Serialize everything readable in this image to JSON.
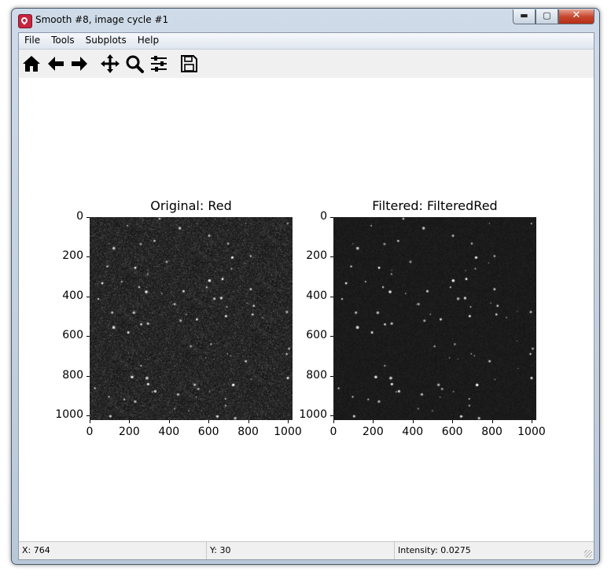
{
  "window": {
    "title": "Smooth #8, image cycle #1"
  },
  "titlebar_buttons": {
    "minimize": "▬",
    "maximize": "▢",
    "close": "✕"
  },
  "menu": [
    "File",
    "Tools",
    "Subplots",
    "Help"
  ],
  "toolbar": [
    {
      "name": "home-icon"
    },
    {
      "name": "back-arrow-icon"
    },
    {
      "name": "forward-arrow-icon"
    },
    {
      "name": "pan-icon"
    },
    {
      "name": "zoom-icon"
    },
    {
      "name": "configure-subplots-icon"
    },
    {
      "name": "save-icon"
    }
  ],
  "plots": [
    {
      "title": "Original: Red",
      "y_ticks": [
        "0",
        "200",
        "400",
        "600",
        "800",
        "1000"
      ],
      "x_ticks": [
        "0",
        "200",
        "400",
        "600",
        "800",
        "1000"
      ]
    },
    {
      "title": "Filtered: FilteredRed",
      "y_ticks": [
        "0",
        "200",
        "400",
        "600",
        "800",
        "1000"
      ],
      "x_ticks": [
        "0",
        "200",
        "400",
        "600",
        "800",
        "1000"
      ]
    }
  ],
  "status": {
    "x": "X: 764",
    "y": "Y: 30",
    "intensity": "Intensity: 0.0275"
  }
}
